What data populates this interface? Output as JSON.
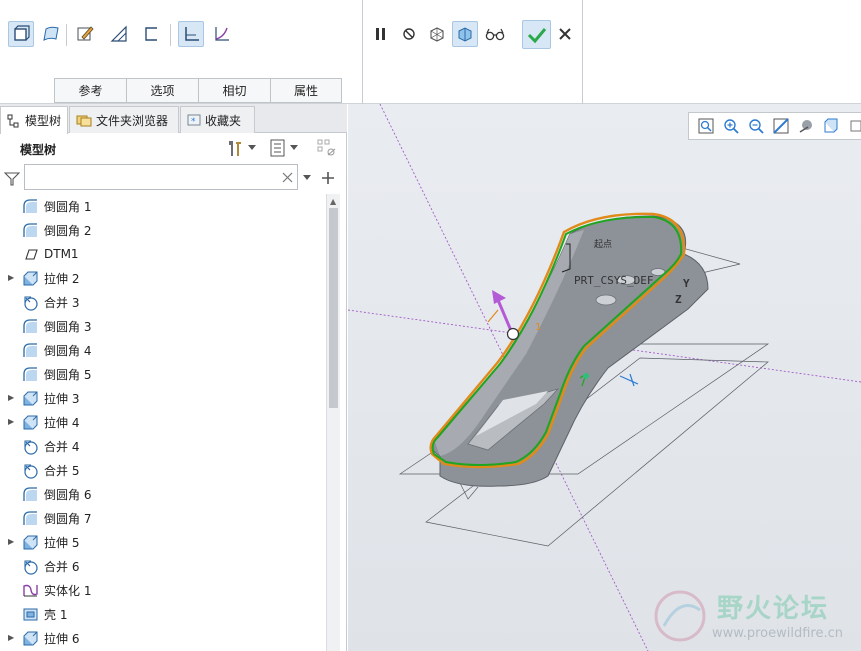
{
  "ribbon": {
    "subtabs": [
      "参考",
      "选项",
      "相切",
      "属性"
    ]
  },
  "panel": {
    "tabs": [
      "模型树",
      "文件夹浏览器",
      "收藏夹"
    ],
    "tree_title": "模型树",
    "filter_placeholder": "",
    "items": [
      {
        "label": "倒圆角 1",
        "icon": "round-icon",
        "expandable": false
      },
      {
        "label": "倒圆角 2",
        "icon": "round-icon",
        "expandable": false
      },
      {
        "label": "DTM1",
        "icon": "datum-plane-icon",
        "expandable": false
      },
      {
        "label": "拉伸 2",
        "icon": "extrude-icon",
        "expandable": true
      },
      {
        "label": "合并 3",
        "icon": "merge-icon",
        "expandable": false
      },
      {
        "label": "倒圆角 3",
        "icon": "round-icon",
        "expandable": false
      },
      {
        "label": "倒圆角 4",
        "icon": "round-icon",
        "expandable": false
      },
      {
        "label": "倒圆角 5",
        "icon": "round-icon",
        "expandable": false
      },
      {
        "label": "拉伸 3",
        "icon": "extrude-icon",
        "expandable": true
      },
      {
        "label": "拉伸 4",
        "icon": "extrude-icon",
        "expandable": true
      },
      {
        "label": "合并 4",
        "icon": "merge-icon",
        "expandable": false
      },
      {
        "label": "合并 5",
        "icon": "merge-icon",
        "expandable": false
      },
      {
        "label": "倒圆角 6",
        "icon": "round-icon",
        "expandable": false
      },
      {
        "label": "倒圆角 7",
        "icon": "round-icon",
        "expandable": false
      },
      {
        "label": "拉伸 5",
        "icon": "extrude-icon",
        "expandable": true
      },
      {
        "label": "合并 6",
        "icon": "merge-icon",
        "expandable": false
      },
      {
        "label": "实体化 1",
        "icon": "solidify-icon",
        "expandable": false
      },
      {
        "label": "壳 1",
        "icon": "shell-icon",
        "expandable": false
      },
      {
        "label": "拉伸 6",
        "icon": "extrude-icon",
        "expandable": true
      }
    ]
  },
  "viewport": {
    "csys_label": "PRT_CSYS_DEF",
    "axis_y": "Y",
    "axis_z": "Z",
    "start_point_label": "起点",
    "marker_label": "1"
  },
  "watermark": {
    "title": "野火论坛",
    "url": "www.proewildfire.cn"
  },
  "colors": {
    "accent": "#2d7bd2",
    "ok_green": "#2aa84a",
    "part_gray": "#8a8f96",
    "edge_green": "#1fa51f",
    "edge_orange": "#e08a1a"
  }
}
